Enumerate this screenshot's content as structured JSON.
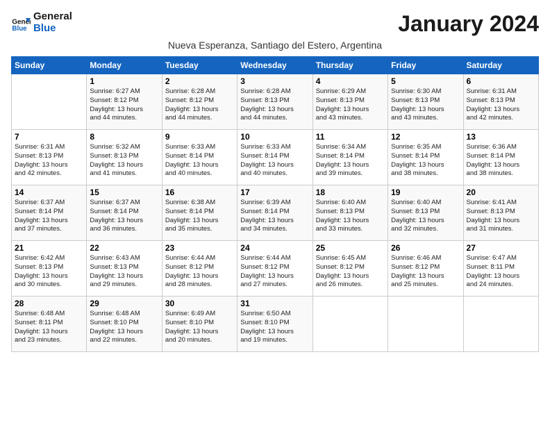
{
  "logo": {
    "line1": "General",
    "line2": "Blue"
  },
  "title": "January 2024",
  "subtitle": "Nueva Esperanza, Santiago del Estero, Argentina",
  "days_of_week": [
    "Sunday",
    "Monday",
    "Tuesday",
    "Wednesday",
    "Thursday",
    "Friday",
    "Saturday"
  ],
  "weeks": [
    [
      {
        "day": "",
        "info": ""
      },
      {
        "day": "1",
        "info": "Sunrise: 6:27 AM\nSunset: 8:12 PM\nDaylight: 13 hours\nand 44 minutes."
      },
      {
        "day": "2",
        "info": "Sunrise: 6:28 AM\nSunset: 8:12 PM\nDaylight: 13 hours\nand 44 minutes."
      },
      {
        "day": "3",
        "info": "Sunrise: 6:28 AM\nSunset: 8:13 PM\nDaylight: 13 hours\nand 44 minutes."
      },
      {
        "day": "4",
        "info": "Sunrise: 6:29 AM\nSunset: 8:13 PM\nDaylight: 13 hours\nand 43 minutes."
      },
      {
        "day": "5",
        "info": "Sunrise: 6:30 AM\nSunset: 8:13 PM\nDaylight: 13 hours\nand 43 minutes."
      },
      {
        "day": "6",
        "info": "Sunrise: 6:31 AM\nSunset: 8:13 PM\nDaylight: 13 hours\nand 42 minutes."
      }
    ],
    [
      {
        "day": "7",
        "info": "Sunrise: 6:31 AM\nSunset: 8:13 PM\nDaylight: 13 hours\nand 42 minutes."
      },
      {
        "day": "8",
        "info": "Sunrise: 6:32 AM\nSunset: 8:13 PM\nDaylight: 13 hours\nand 41 minutes."
      },
      {
        "day": "9",
        "info": "Sunrise: 6:33 AM\nSunset: 8:14 PM\nDaylight: 13 hours\nand 40 minutes."
      },
      {
        "day": "10",
        "info": "Sunrise: 6:33 AM\nSunset: 8:14 PM\nDaylight: 13 hours\nand 40 minutes."
      },
      {
        "day": "11",
        "info": "Sunrise: 6:34 AM\nSunset: 8:14 PM\nDaylight: 13 hours\nand 39 minutes."
      },
      {
        "day": "12",
        "info": "Sunrise: 6:35 AM\nSunset: 8:14 PM\nDaylight: 13 hours\nand 38 minutes."
      },
      {
        "day": "13",
        "info": "Sunrise: 6:36 AM\nSunset: 8:14 PM\nDaylight: 13 hours\nand 38 minutes."
      }
    ],
    [
      {
        "day": "14",
        "info": "Sunrise: 6:37 AM\nSunset: 8:14 PM\nDaylight: 13 hours\nand 37 minutes."
      },
      {
        "day": "15",
        "info": "Sunrise: 6:37 AM\nSunset: 8:14 PM\nDaylight: 13 hours\nand 36 minutes."
      },
      {
        "day": "16",
        "info": "Sunrise: 6:38 AM\nSunset: 8:14 PM\nDaylight: 13 hours\nand 35 minutes."
      },
      {
        "day": "17",
        "info": "Sunrise: 6:39 AM\nSunset: 8:14 PM\nDaylight: 13 hours\nand 34 minutes."
      },
      {
        "day": "18",
        "info": "Sunrise: 6:40 AM\nSunset: 8:13 PM\nDaylight: 13 hours\nand 33 minutes."
      },
      {
        "day": "19",
        "info": "Sunrise: 6:40 AM\nSunset: 8:13 PM\nDaylight: 13 hours\nand 32 minutes."
      },
      {
        "day": "20",
        "info": "Sunrise: 6:41 AM\nSunset: 8:13 PM\nDaylight: 13 hours\nand 31 minutes."
      }
    ],
    [
      {
        "day": "21",
        "info": "Sunrise: 6:42 AM\nSunset: 8:13 PM\nDaylight: 13 hours\nand 30 minutes."
      },
      {
        "day": "22",
        "info": "Sunrise: 6:43 AM\nSunset: 8:13 PM\nDaylight: 13 hours\nand 29 minutes."
      },
      {
        "day": "23",
        "info": "Sunrise: 6:44 AM\nSunset: 8:12 PM\nDaylight: 13 hours\nand 28 minutes."
      },
      {
        "day": "24",
        "info": "Sunrise: 6:44 AM\nSunset: 8:12 PM\nDaylight: 13 hours\nand 27 minutes."
      },
      {
        "day": "25",
        "info": "Sunrise: 6:45 AM\nSunset: 8:12 PM\nDaylight: 13 hours\nand 26 minutes."
      },
      {
        "day": "26",
        "info": "Sunrise: 6:46 AM\nSunset: 8:12 PM\nDaylight: 13 hours\nand 25 minutes."
      },
      {
        "day": "27",
        "info": "Sunrise: 6:47 AM\nSunset: 8:11 PM\nDaylight: 13 hours\nand 24 minutes."
      }
    ],
    [
      {
        "day": "28",
        "info": "Sunrise: 6:48 AM\nSunset: 8:11 PM\nDaylight: 13 hours\nand 23 minutes."
      },
      {
        "day": "29",
        "info": "Sunrise: 6:48 AM\nSunset: 8:10 PM\nDaylight: 13 hours\nand 22 minutes."
      },
      {
        "day": "30",
        "info": "Sunrise: 6:49 AM\nSunset: 8:10 PM\nDaylight: 13 hours\nand 20 minutes."
      },
      {
        "day": "31",
        "info": "Sunrise: 6:50 AM\nSunset: 8:10 PM\nDaylight: 13 hours\nand 19 minutes."
      },
      {
        "day": "",
        "info": ""
      },
      {
        "day": "",
        "info": ""
      },
      {
        "day": "",
        "info": ""
      }
    ]
  ]
}
